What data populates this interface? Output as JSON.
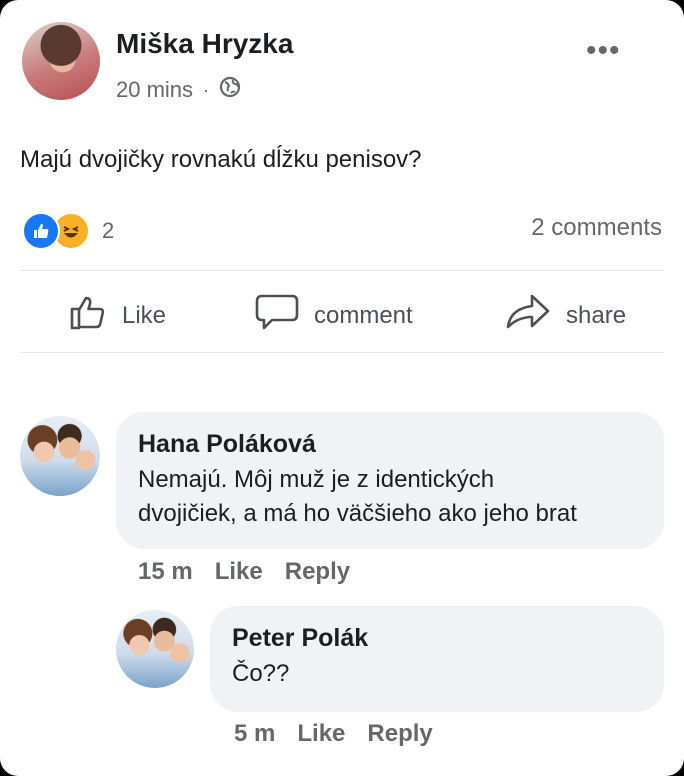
{
  "post": {
    "author": "Miška Hryzka",
    "time": "20 mins",
    "separator": "·",
    "privacy_icon": "globe-icon",
    "more_label": "•••",
    "text": "Majú dvojičky rovnakú dĺžku penisov?",
    "reaction_icons": [
      "like-reaction-icon",
      "haha-reaction-icon"
    ],
    "reaction_count": "2",
    "comments_count": "2 comments"
  },
  "actions": {
    "like": "Like",
    "comment": "comment",
    "share": "share"
  },
  "comments": [
    {
      "author": "Hana Poláková",
      "line1": "Nemajú. Môj muž je z identických",
      "line2": "dvojičiek, a má ho väčšieho ako jeho brat",
      "time": "15 m",
      "like": "Like",
      "reply": "Reply"
    },
    {
      "author": "Peter Polák",
      "line1": "Čo??",
      "time": "5 m",
      "like": "Like",
      "reply": "Reply"
    }
  ],
  "colors": {
    "accent": "#1877f2",
    "muted": "#65676b",
    "bubble": "#f0f2f5"
  }
}
